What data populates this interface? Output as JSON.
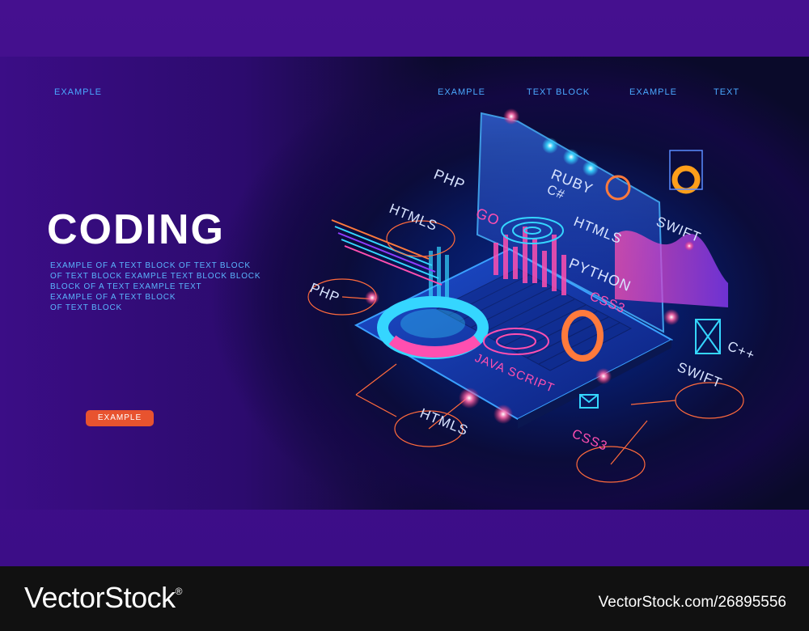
{
  "nav": {
    "left": "EXAMPLE",
    "items": [
      "EXAMPLE",
      "TEXT BLOCK",
      "EXAMPLE",
      "TEXT"
    ]
  },
  "hero": {
    "title": "CODING",
    "body_lines": [
      "EXAMPLE OF A TEXT BLOCK OF TEXT BLOCK",
      "OF TEXT BLOCK EXAMPLE TEXT BLOCK BLOCK",
      "BLOCK OF A TEXT EXAMPLE TEXT",
      "EXAMPLE OF A TEXT BLOCK",
      "OF TEXT BLOCK"
    ],
    "cta_label": "EXAMPLE"
  },
  "illustration": {
    "labels": {
      "php_top": "PHP",
      "ruby": "RUBY",
      "csharp": "C#",
      "go": "GO",
      "htmls_left": "HTMLS",
      "htmls_mid": "HTMLS",
      "swift_top": "SWIFT",
      "python": "PYTHON",
      "css3_mid": "CSS3",
      "php_left": "PHP",
      "cpp": "C++",
      "java_script": "JAVA SCRIPT",
      "swift_right": "SWIFT",
      "htmls_bottom": "HTMLS",
      "css3_bottom": "CSS3"
    },
    "colors": {
      "cyan": "#35d6ff",
      "pink": "#ff4fb0",
      "orange": "#ff7a3c",
      "blue": "#2e6bff",
      "violet": "#8f3cff"
    }
  },
  "footer": {
    "logo": "VectorStock",
    "registered": "®",
    "stock_url": "VectorStock.com/26895556"
  }
}
